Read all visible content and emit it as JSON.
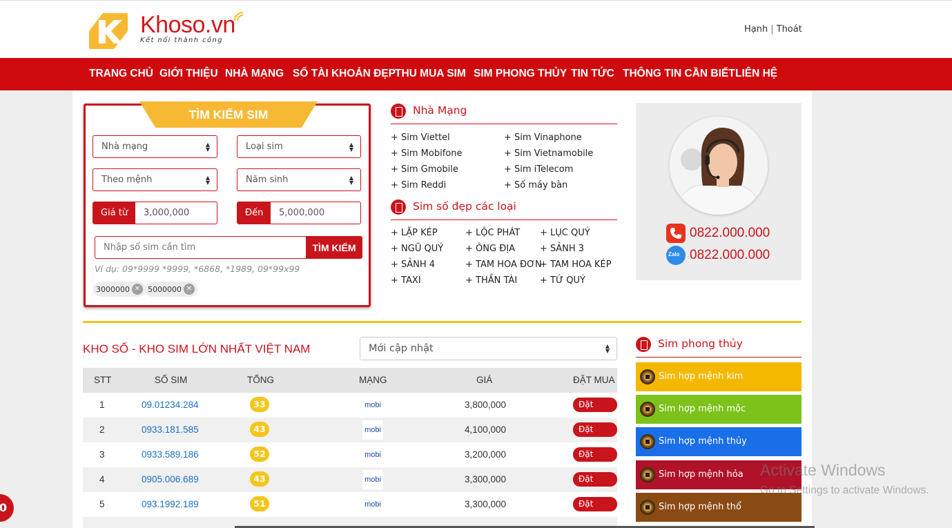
{
  "brand": {
    "name": "Khoso.vn",
    "tagline": "Kết nối thành công"
  },
  "user_links": {
    "user": "Hạnh",
    "separator": "|",
    "logout": "Thoát"
  },
  "nav": [
    "TRANG CHỦ",
    "GIỚI THIỆU",
    "NHÀ MẠNG",
    "SỐ TÀI KHOẢN ĐẸP",
    "THU MUA SIM",
    "SIM PHONG THỦY",
    "TIN TỨC",
    "THÔNG TIN CẦN BIẾT",
    "LIÊN HỆ"
  ],
  "search": {
    "title": "TÌM KIẾM SIM",
    "carrier_select": "Nhà mạng",
    "type_select": "Loại sim",
    "element_select": "Theo mệnh",
    "year_select": "Năm sinh",
    "price_from_label": "Giá từ",
    "price_from_value": "3,000,000",
    "price_to_label": "Đến",
    "price_to_value": "5,000,000",
    "input_placeholder": "Nhập số sim cần tìm",
    "button": "TÌM KIẾM",
    "example": "Ví dụ: 09*9999 *9999, *6868, *1989, 09*99x99",
    "chips": [
      "3000000",
      "5000000"
    ]
  },
  "carriers_section": {
    "title": "Nhà Mạng",
    "items": [
      "+ Sim Viettel",
      "+ Sim Vinaphone",
      "+ Sim Mobifone",
      "+ Sim Vietnamobile",
      "+ Sim Gmobile",
      "+ Sim iTelecom",
      "+ Sim Reddi",
      "+ Số máy bàn"
    ]
  },
  "beautiful_section": {
    "title": "Sim số đẹp các loại",
    "items": [
      "+ LẶP KÉP",
      "+ LỘC PHÁT",
      "+ LỤC QUÝ",
      "+ NGŨ QUÝ",
      "+ ÔNG ĐỊA",
      "+ SẢNH 3",
      "+ SẢNH 4",
      "+ TAM HOA ĐƠN",
      "+ TAM HOA KÉP",
      "+ TAXI",
      "+ THẦN TÀI",
      "+ TỨ QUÝ"
    ]
  },
  "support": {
    "phone": "0822.000.000",
    "zalo": "0822.000.000",
    "zalo_label": "Zalo"
  },
  "list": {
    "title": "KHO SỐ - KHO SIM LỚN NHẤT VIỆT NAM",
    "sort": "Mới cập nhật",
    "columns": [
      "STT",
      "SỐ SIM",
      "TỔNG",
      "MẠNG",
      "GIÁ",
      "ĐẶT MUA"
    ],
    "rows": [
      {
        "stt": "1",
        "sim": "09.01234.284",
        "total": "33",
        "carrier": "mobi",
        "price": "3,800,000",
        "order": "Đặt mua"
      },
      {
        "stt": "2",
        "sim": "0933.181.585",
        "total": "43",
        "carrier": "mobi",
        "price": "4,100,000",
        "order": "Đặt mua"
      },
      {
        "stt": "3",
        "sim": "0933.589.186",
        "total": "52",
        "carrier": "mobi",
        "price": "3,200,000",
        "order": "Đặt mua"
      },
      {
        "stt": "4",
        "sim": "0905.006.689",
        "total": "43",
        "carrier": "mobi",
        "price": "3,300,000",
        "order": "Đặt mua"
      },
      {
        "stt": "5",
        "sim": "093.1992.189",
        "total": "51",
        "carrier": "mobi",
        "price": "3,300,000",
        "order": "Đặt mua"
      }
    ]
  },
  "feng_shui": {
    "title": "Sim phong thủy",
    "items": [
      {
        "label": "Sim hợp mệnh kim",
        "color": "#f5b800"
      },
      {
        "label": "Sim hợp mệnh mộc",
        "color": "#7cc21b"
      },
      {
        "label": "Sim hợp mệnh thủy",
        "color": "#1a6fe8"
      },
      {
        "label": "Sim hợp mệnh hỏa",
        "color": "#b0122a"
      },
      {
        "label": "Sim hợp mệnh thổ",
        "color": "#8a4a14"
      }
    ]
  },
  "watermark": {
    "line1": "Activate Windows",
    "line2": "Go to Settings to activate Windows."
  },
  "floating_badge": "0",
  "colors": {
    "primary_red": "#cf0a0e",
    "accent_yellow": "#f5c518",
    "link_blue": "#1a6fc9"
  }
}
